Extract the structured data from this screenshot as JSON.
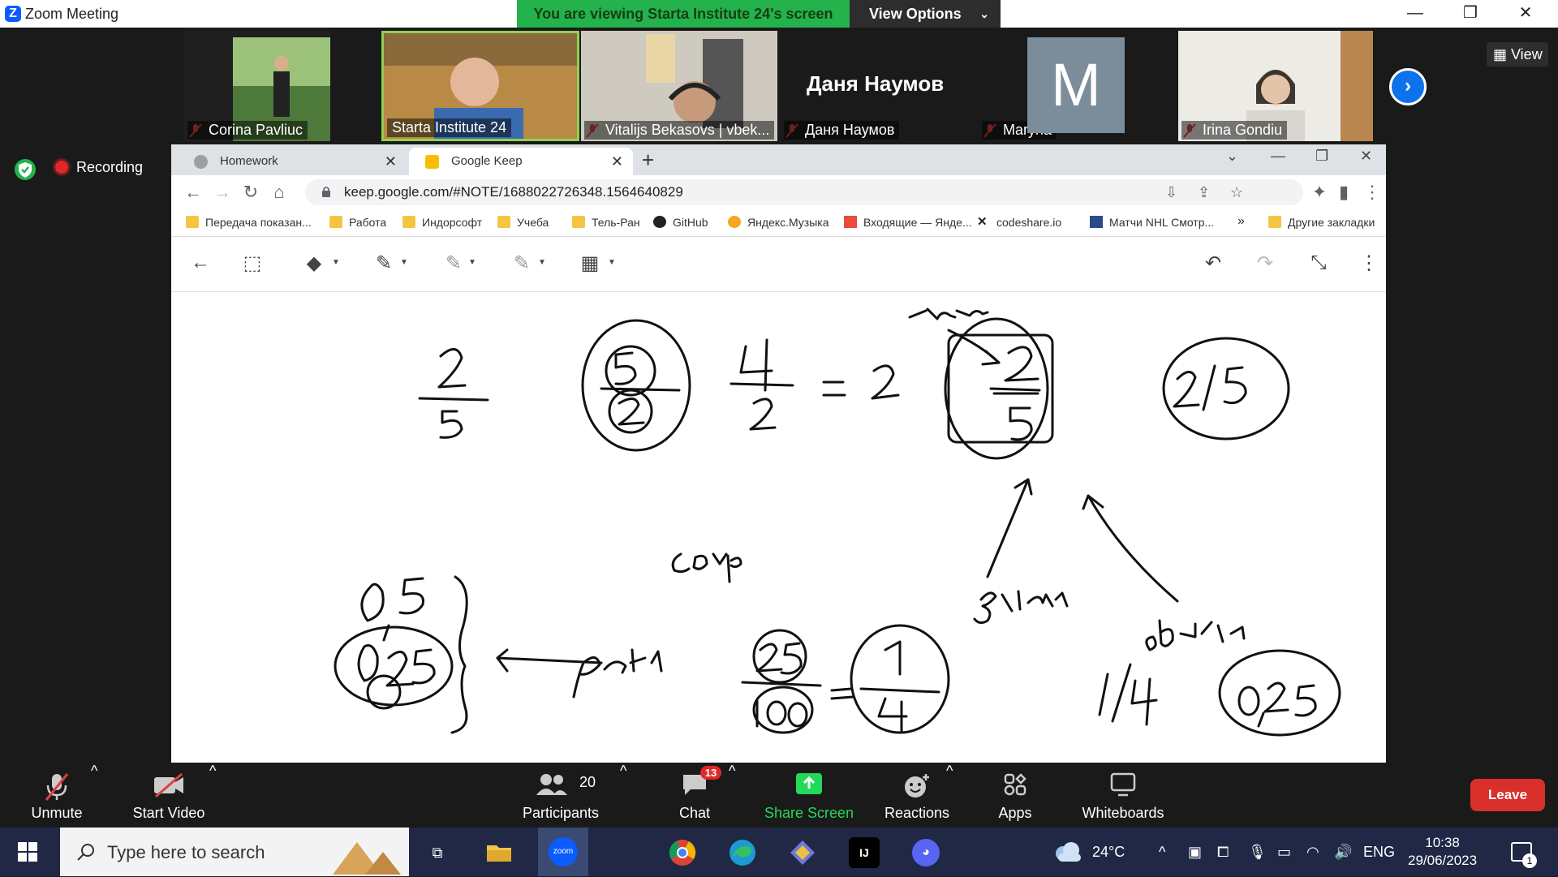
{
  "zoom": {
    "window_title": "Zoom Meeting",
    "viewing_banner": "You are viewing Starta Institute 24's screen",
    "view_options": "View Options",
    "view_button": "View",
    "recording": "Recording",
    "participants": [
      {
        "name": "Corina Pavliuc",
        "muted": true
      },
      {
        "name": "Starta Institute 24",
        "muted": false,
        "speaking": true
      },
      {
        "name": "Vitalijs Bekasovs | vbek...",
        "muted": true
      },
      {
        "name": "Даня Наумов",
        "muted": true,
        "display_name": "Даня Наумов"
      },
      {
        "name": "Maryna",
        "muted": true,
        "avatar_letter": "M"
      },
      {
        "name": "Irina Gondiu",
        "muted": true
      }
    ],
    "controls": {
      "unmute": "Unmute",
      "start_video": "Start Video",
      "participants": "Participants",
      "participants_count": "20",
      "chat": "Chat",
      "chat_badge": "13",
      "share_screen": "Share Screen",
      "reactions": "Reactions",
      "apps": "Apps",
      "whiteboards": "Whiteboards",
      "leave": "Leave"
    }
  },
  "browser": {
    "tabs": [
      {
        "title": "Homework",
        "active": false
      },
      {
        "title": "Google Keep",
        "active": true
      }
    ],
    "url": "keep.google.com/#NOTE/1688022726348.1564640829",
    "bookmarks": [
      {
        "label": "Передача показан...",
        "icon": "folder"
      },
      {
        "label": "Работа",
        "icon": "folder"
      },
      {
        "label": "Индорсофт",
        "icon": "folder"
      },
      {
        "label": "Учеба",
        "icon": "folder"
      },
      {
        "label": "Тель-Ран",
        "icon": "folder"
      },
      {
        "label": "GitHub",
        "icon": "github-icon"
      },
      {
        "label": "Яндекс.Музыка",
        "icon": "yandex-music-icon"
      },
      {
        "label": "Входящие — Янде...",
        "icon": "mail-icon"
      },
      {
        "label": "codeshare.io",
        "icon": "codeshare-icon"
      },
      {
        "label": "Матчи NHL Смотр...",
        "icon": "nhl-icon"
      }
    ],
    "more_bookmarks": "»",
    "other_bookmarks": "Другие закладки"
  },
  "keep_drawing": {
    "notes": [
      "2/5",
      "5/2",
      "4/2 = 2",
      "числ.",
      "2/5",
      "знам.",
      "обычн.",
      "2/5",
      "0,5",
      "0,25",
      "десят.",
      "сокр.",
      "25/100 = 1/4",
      "1/4",
      "0,25"
    ]
  },
  "taskbar": {
    "search_placeholder": "Type here to search",
    "weather": "24°C",
    "lang": "ENG",
    "time": "10:38",
    "date": "29/06/2023",
    "notifications": "1"
  },
  "colors": {
    "zoom_blue": "#0b5cff",
    "banner_green": "#23b24b",
    "leave_red": "#d9302c",
    "share_green": "#23d959"
  }
}
